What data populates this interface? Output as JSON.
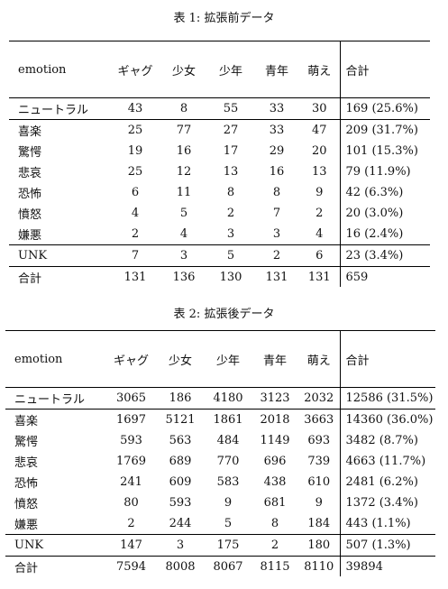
{
  "table1": {
    "caption": "表 1: 拡張前データ",
    "headers": [
      "emotion",
      "ギャグ",
      "少女",
      "少年",
      "青年",
      "萌え",
      "合計"
    ],
    "rows": [
      {
        "label": "ニュートラル",
        "vals": [
          "43",
          "8",
          "55",
          "33",
          "30"
        ],
        "total": "169 (25.6%)"
      },
      {
        "label": "喜楽",
        "vals": [
          "25",
          "77",
          "27",
          "33",
          "47"
        ],
        "total": "209 (31.7%)"
      },
      {
        "label": "驚愕",
        "vals": [
          "19",
          "16",
          "17",
          "29",
          "20"
        ],
        "total": "101 (15.3%)"
      },
      {
        "label": "悲哀",
        "vals": [
          "25",
          "12",
          "13",
          "16",
          "13"
        ],
        "total": "79 (11.9%)"
      },
      {
        "label": "恐怖",
        "vals": [
          "6",
          "11",
          "8",
          "8",
          "9"
        ],
        "total": "42 (6.3%)"
      },
      {
        "label": "憤怒",
        "vals": [
          "4",
          "5",
          "2",
          "7",
          "2"
        ],
        "total": "20 (3.0%)"
      },
      {
        "label": "嫌悪",
        "vals": [
          "2",
          "4",
          "3",
          "3",
          "4"
        ],
        "total": "16 (2.4%)"
      },
      {
        "label": "UNK",
        "vals": [
          "7",
          "3",
          "5",
          "2",
          "6"
        ],
        "total": "23 (3.4%)"
      },
      {
        "label": "合計",
        "vals": [
          "131",
          "136",
          "130",
          "131",
          "131"
        ],
        "total": "659"
      }
    ]
  },
  "table2": {
    "caption": "表 2: 拡張後データ",
    "headers": [
      "emotion",
      "ギャグ",
      "少女",
      "少年",
      "青年",
      "萌え",
      "合計"
    ],
    "rows": [
      {
        "label": "ニュートラル",
        "vals": [
          "3065",
          "186",
          "4180",
          "3123",
          "2032"
        ],
        "total": "12586 (31.5%)"
      },
      {
        "label": "喜楽",
        "vals": [
          "1697",
          "5121",
          "1861",
          "2018",
          "3663"
        ],
        "total": "14360 (36.0%)"
      },
      {
        "label": "驚愕",
        "vals": [
          "593",
          "563",
          "484",
          "1149",
          "693"
        ],
        "total": "3482 (8.7%)"
      },
      {
        "label": "悲哀",
        "vals": [
          "1769",
          "689",
          "770",
          "696",
          "739"
        ],
        "total": "4663 (11.7%)"
      },
      {
        "label": "恐怖",
        "vals": [
          "241",
          "609",
          "583",
          "438",
          "610"
        ],
        "total": "2481 (6.2%)"
      },
      {
        "label": "憤怒",
        "vals": [
          "80",
          "593",
          "9",
          "681",
          "9"
        ],
        "total": "1372 (3.4%)"
      },
      {
        "label": "嫌悪",
        "vals": [
          "2",
          "244",
          "5",
          "8",
          "184"
        ],
        "total": "443 (1.1%)"
      },
      {
        "label": "UNK",
        "vals": [
          "147",
          "3",
          "175",
          "2",
          "180"
        ],
        "total": "507 (1.3%)"
      },
      {
        "label": "合計",
        "vals": [
          "7594",
          "8008",
          "8067",
          "8115",
          "8110"
        ],
        "total": "39894"
      }
    ]
  }
}
